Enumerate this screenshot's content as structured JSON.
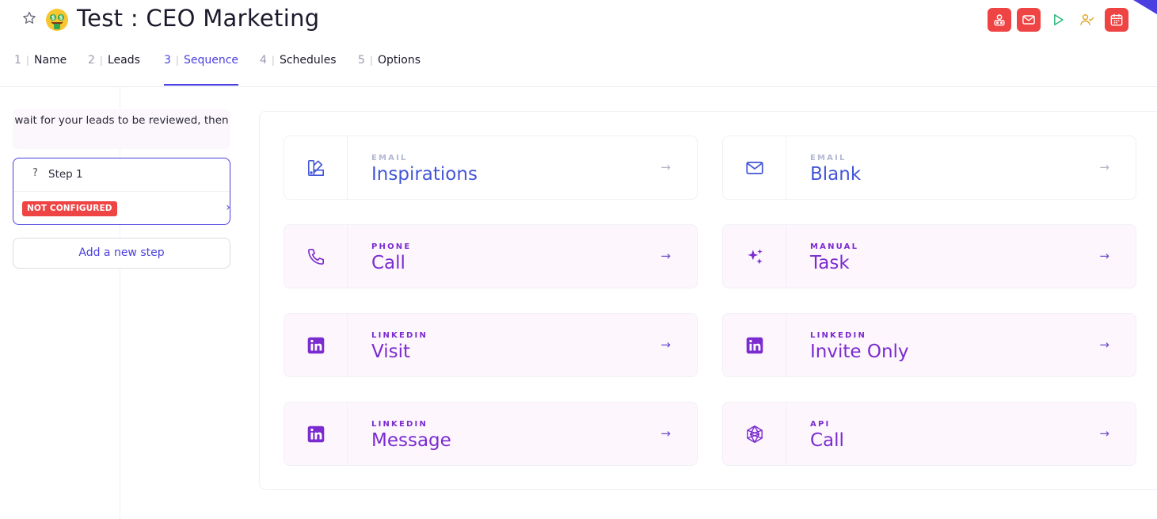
{
  "header": {
    "title": "Test : CEO Marketing",
    "icons": [
      "star-icon",
      "money-face-emoji",
      "contact-card-icon",
      "email-icon",
      "play-icon",
      "user-check-icon",
      "calendar-icon"
    ]
  },
  "tabs": [
    {
      "num": "1",
      "label": "Name",
      "active": false
    },
    {
      "num": "2",
      "label": "Leads",
      "active": false
    },
    {
      "num": "3",
      "label": "Sequence",
      "active": true
    },
    {
      "num": "4",
      "label": "Schedules",
      "active": false
    },
    {
      "num": "5",
      "label": "Options",
      "active": false
    }
  ],
  "sidebar": {
    "wait_text": "wait for your leads to be reviewed, then",
    "step": {
      "name": "Step 1",
      "status": "NOT CONFIGURED"
    },
    "add_step_label": "Add a new step"
  },
  "steps_menu": [
    {
      "kind": "EMAIL",
      "name": "Inspirations",
      "icon": "palette-icon"
    },
    {
      "kind": "EMAIL",
      "name": "Blank",
      "icon": "envelope-icon"
    },
    {
      "kind": "PHONE",
      "name": "Call",
      "icon": "phone-icon"
    },
    {
      "kind": "MANUAL",
      "name": "Task",
      "icon": "sparkles-icon"
    },
    {
      "kind": "LINKEDIN",
      "name": "Visit",
      "icon": "linkedin-icon"
    },
    {
      "kind": "LINKEDIN",
      "name": "Invite Only",
      "icon": "linkedin-icon"
    },
    {
      "kind": "LINKEDIN",
      "name": "Message",
      "icon": "linkedin-icon"
    },
    {
      "kind": "API",
      "name": "Call",
      "icon": "api-icon"
    }
  ],
  "colors": {
    "accent": "#4a3fe0",
    "purple": "#7b2bd0",
    "email_blue": "#4356d8",
    "danger": "#ef4444"
  }
}
